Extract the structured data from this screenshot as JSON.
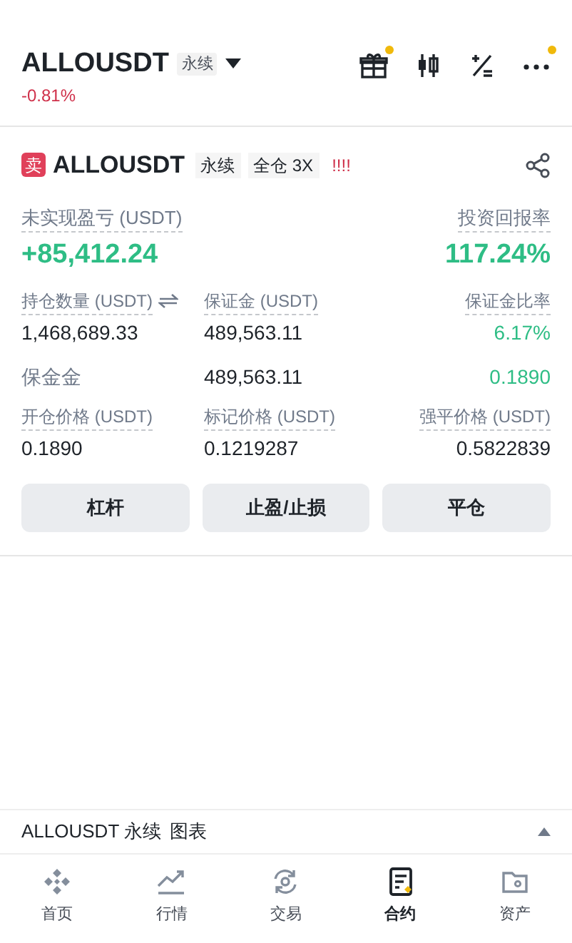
{
  "header": {
    "symbol": "ALLOUSDT",
    "contract": "永续",
    "change": "-0.81%"
  },
  "toolbar": [
    {
      "kind": "gift",
      "badge": true
    },
    {
      "kind": "candles"
    },
    {
      "kind": "plusminus"
    },
    {
      "kind": "more",
      "badge": true
    }
  ],
  "position": {
    "side": "卖",
    "symbol": "ALLOUSDT",
    "contract": "永续",
    "margin": "全仓 3X",
    "warning": "!!!!"
  },
  "pnl": {
    "label": "未实现盈亏 (USDT)",
    "value": "+85,412.24"
  },
  "roi": {
    "label": "投资回报率",
    "value": "117.24%"
  },
  "stats": [
    {
      "cells": [
        {
          "label": "持仓数量 (USDT)",
          "swap": true,
          "value": "1,468,689.33",
          "green": false
        },
        {
          "label": "保证金 (USDT)",
          "value": "489,563.11",
          "green": false
        },
        {
          "label": "保证金比率",
          "value": "6.17%",
          "green": true
        }
      ]
    },
    {
      "cells": [
        {
          "value": "保金金",
          "green": false,
          "muted": true
        },
        {
          "value": "489,563.11",
          "green": false
        },
        {
          "value": "0.1890",
          "green": true
        }
      ]
    },
    {
      "cells": [
        {
          "label": "开仓价格 (USDT)",
          "value": "0.1890",
          "green": false
        },
        {
          "label": "标记价格 (USDT)",
          "value": "0.1219287",
          "green": false
        },
        {
          "label": "强平价格 (USDT)",
          "value": "0.5822839",
          "green": false
        }
      ]
    }
  ],
  "buttons": [
    "杠杆",
    "止盈/止损",
    "平仓"
  ],
  "chart_bar": {
    "title": "ALLOUSDT 永续",
    "label": "图表"
  },
  "nav": [
    {
      "kind": "home",
      "label": "首页",
      "selected": false
    },
    {
      "kind": "markets",
      "label": "行情",
      "selected": false
    },
    {
      "kind": "trade",
      "label": "交易",
      "selected": false
    },
    {
      "kind": "futures",
      "label": "合约",
      "selected": true
    },
    {
      "kind": "assets",
      "label": "资产",
      "selected": false
    }
  ]
}
